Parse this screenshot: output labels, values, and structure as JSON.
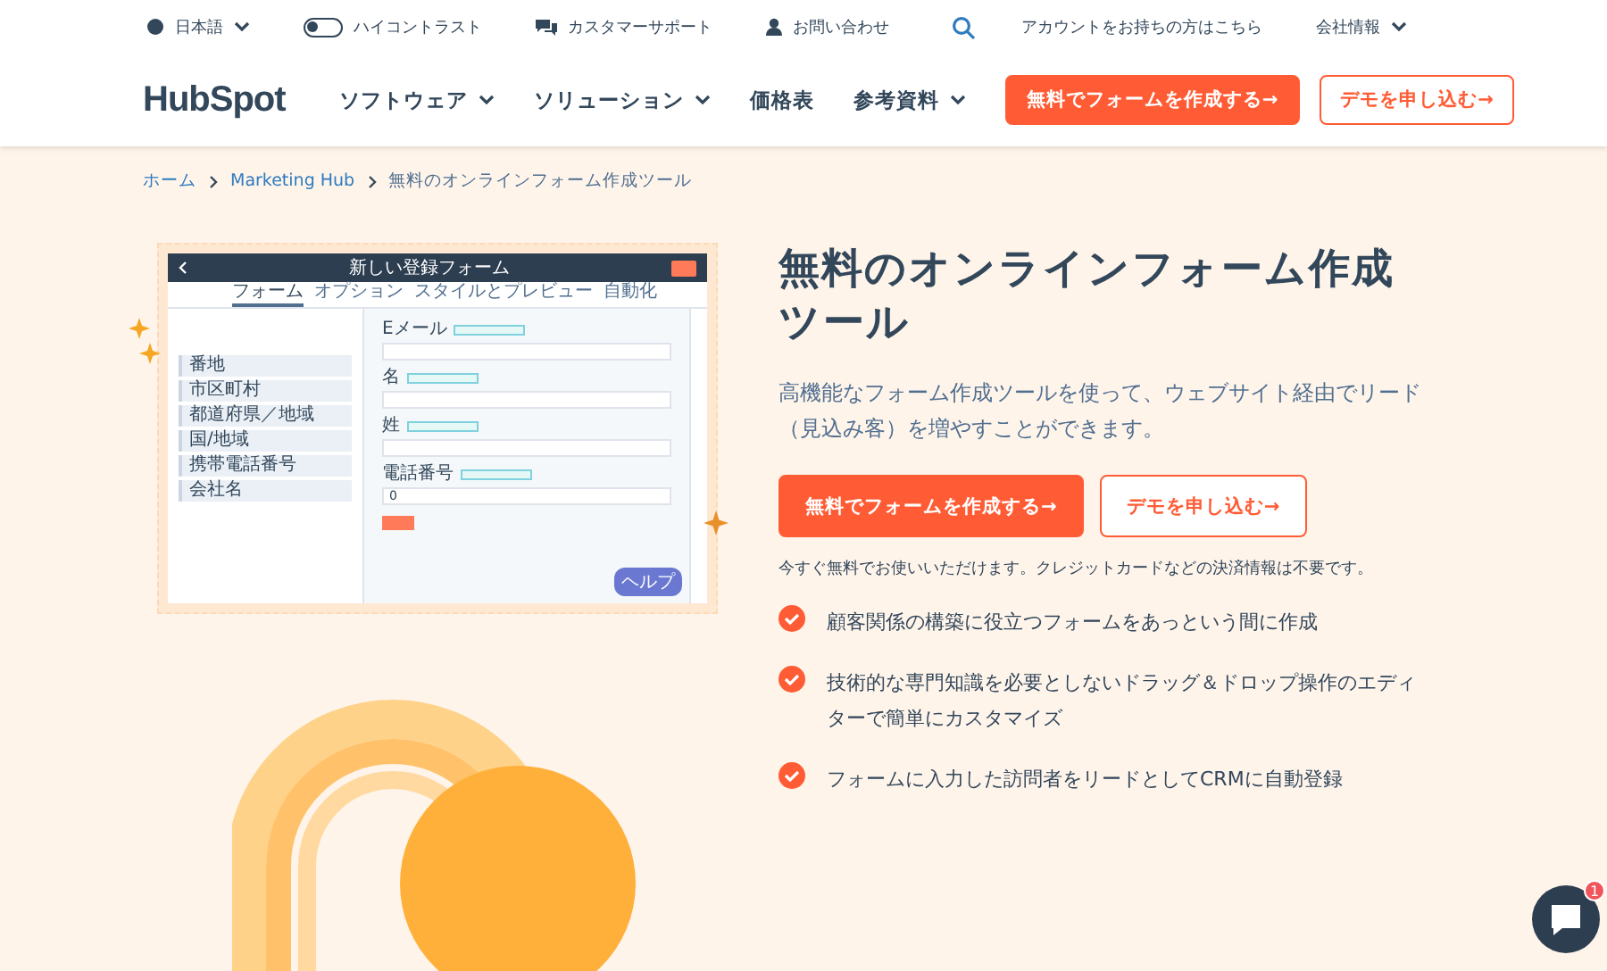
{
  "utility_bar": {
    "left": [
      {
        "kind": "language",
        "label": "日本語"
      },
      {
        "kind": "toggle",
        "label": "ハイコントラスト",
        "on": false
      },
      {
        "kind": "support",
        "label": "カスタマーサポート"
      },
      {
        "kind": "contact",
        "label": "お問い合わせ"
      }
    ],
    "right": [
      {
        "kind": "search"
      },
      {
        "kind": "link",
        "label": "アカウントをお持ちの方はこちら"
      },
      {
        "kind": "menu",
        "label": "会社情報"
      }
    ]
  },
  "nav": {
    "logo": "HubSpot",
    "items": [
      {
        "label": "ソフトウェア",
        "dropdown": true
      },
      {
        "label": "ソリューション",
        "dropdown": true
      },
      {
        "label": "価格表",
        "dropdown": false
      },
      {
        "label": "参考資料",
        "dropdown": true
      }
    ],
    "buttons": [
      {
        "kind": "primary",
        "label": "無料でフォームを作成する→"
      },
      {
        "kind": "secondary",
        "label": "デモを申し込む→"
      }
    ]
  },
  "breadcrumb": [
    {
      "label": "ホーム",
      "link": true
    },
    {
      "label": "Marketing Hub",
      "link": true
    },
    {
      "label": "無料のオンラインフォーム作成ツール",
      "link": false
    }
  ],
  "mockup": {
    "title": "新しい登録フォーム",
    "tabs": [
      {
        "label": "フォーム",
        "selected": true
      },
      {
        "label": "オプション",
        "selected": false
      },
      {
        "label": "スタイルとプレビュー",
        "selected": false
      },
      {
        "label": "自動化",
        "selected": false
      }
    ],
    "properties": [
      {
        "label": "番地"
      },
      {
        "label": "市区町村"
      },
      {
        "label": "都道府県／地域"
      },
      {
        "label": "国/地域"
      },
      {
        "label": "携帯電話番号"
      },
      {
        "label": "会社名"
      }
    ],
    "fields": [
      {
        "label": "Eメール"
      },
      {
        "label": "名"
      },
      {
        "label": "姓"
      },
      {
        "label": "電話番号",
        "value": "0"
      }
    ],
    "help": "ヘルプ"
  },
  "hero": {
    "title": "無料のオンラインフォーム作成ツール",
    "description": "高機能なフォーム作成ツールを使って、ウェブサイト経由でリード（見込み客）を増やすことができます。",
    "buttons": [
      {
        "kind": "primary",
        "label": "無料でフォームを作成する→"
      },
      {
        "kind": "secondary",
        "label": "デモを申し込む→"
      }
    ],
    "note": "今すぐ無料でお使いいただけます。クレジットカードなどの決済情報は不要です。",
    "features": [
      "顧客関係の構築に役立つフォームをあっという間に作成",
      "技術的な専門知識を必要としないドラッグ＆ドロップ操作のエディターで簡単にカスタマイズ",
      "フォームに入力した訪問者をリードとしてCRMに自動登録"
    ]
  },
  "chat": {
    "badge": "1"
  }
}
